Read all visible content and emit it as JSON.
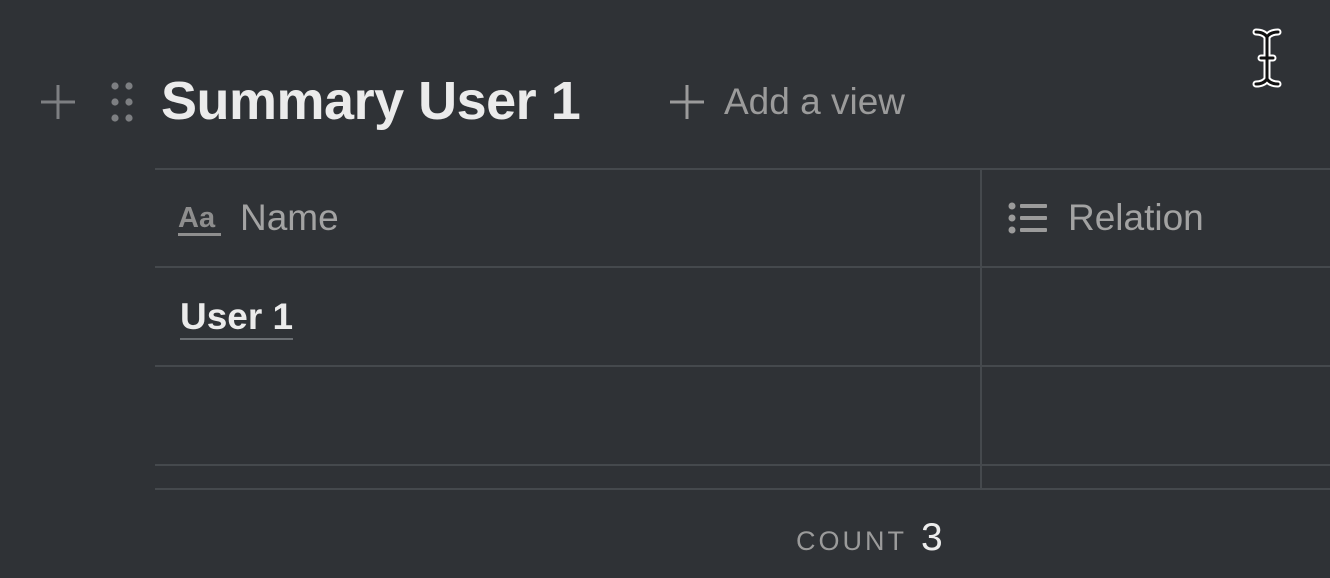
{
  "database": {
    "title": "Summary User 1",
    "add_view_label": "Add a view"
  },
  "table": {
    "columns": [
      {
        "label": "Name",
        "icon": "title-property-icon"
      },
      {
        "label": "Relation",
        "icon": "relation-list-icon"
      }
    ],
    "rows": [
      {
        "name": "User 1",
        "relation": ""
      },
      {
        "name": "",
        "relation": ""
      }
    ],
    "footer": {
      "count_label": "COUNT",
      "count_value": "3"
    }
  },
  "colors": {
    "background": "#2f3236",
    "text": "#ebebeb",
    "muted_text": "#9b9b9b",
    "divider": "#45494d"
  }
}
